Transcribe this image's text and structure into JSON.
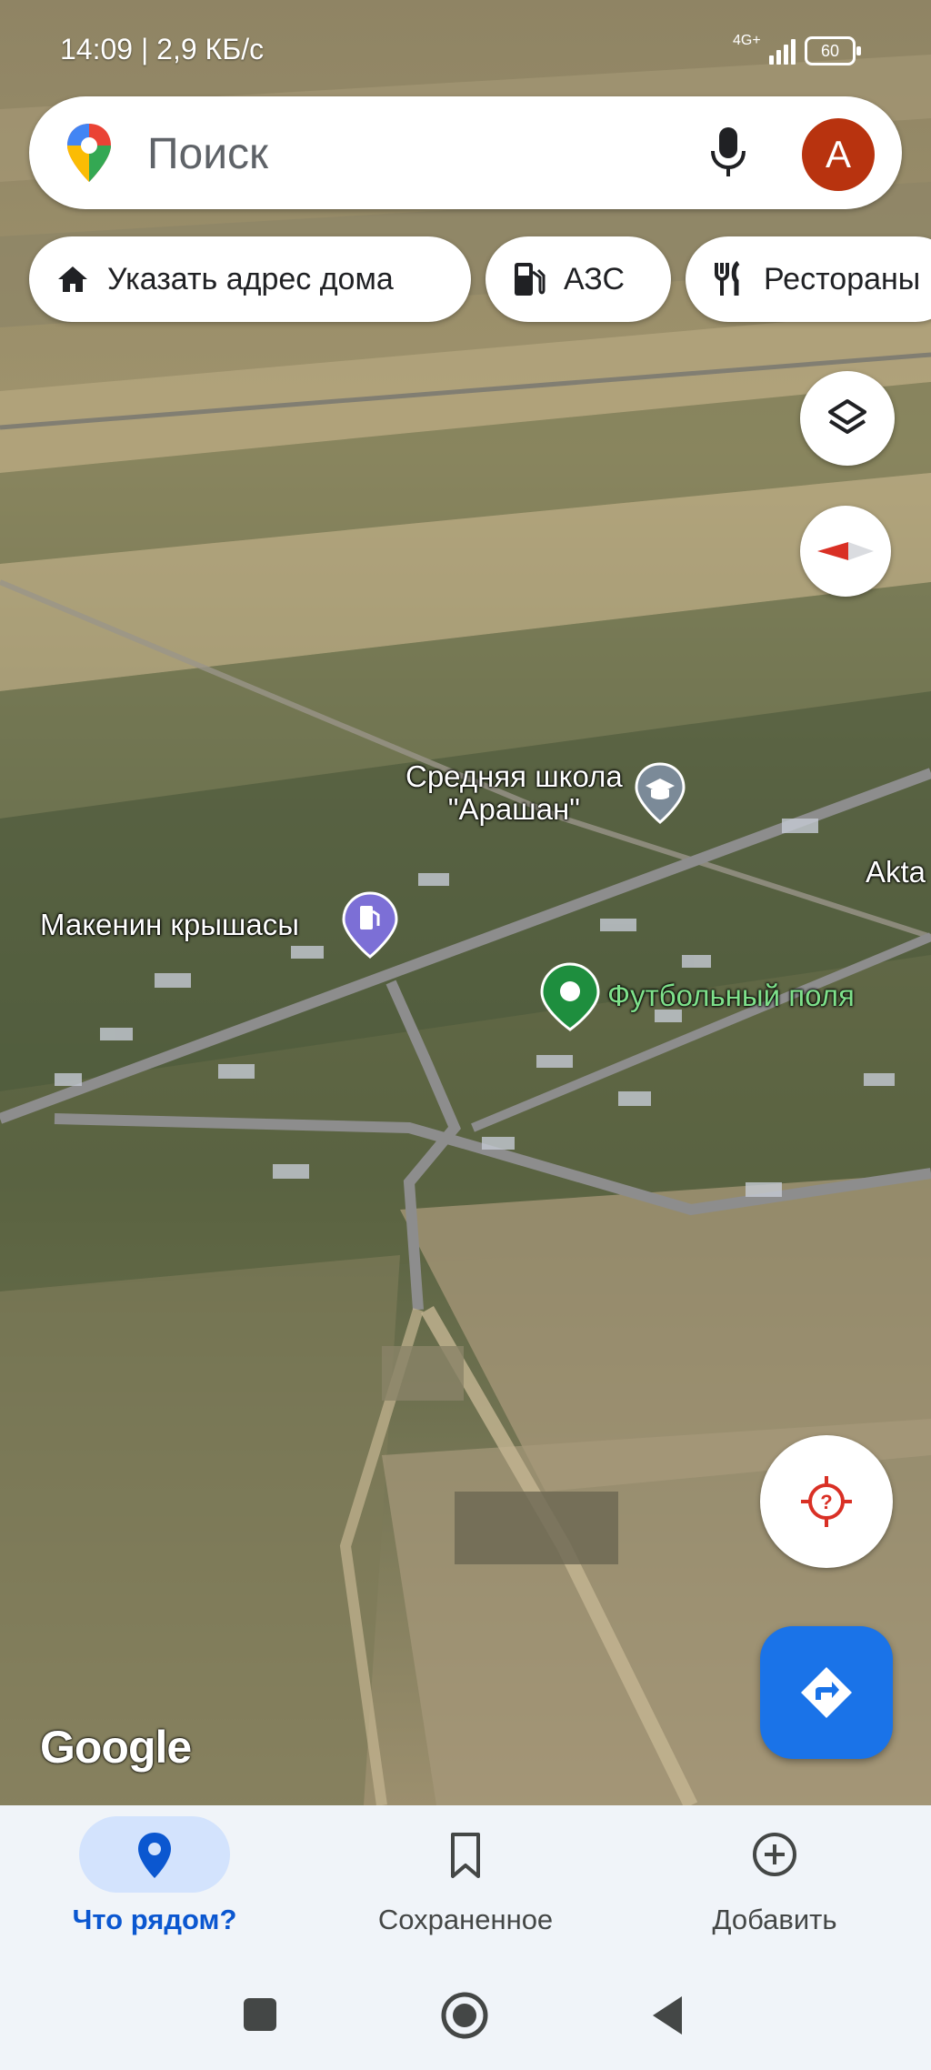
{
  "status_bar": {
    "time": "14:09 | 2,9 КБ/с",
    "network": "4G+",
    "battery": "60"
  },
  "search": {
    "placeholder": "Поиск",
    "avatar_letter": "A",
    "avatar_color": "#b8330f"
  },
  "chips": [
    {
      "label": "Указать адрес дома",
      "icon": "home-icon"
    },
    {
      "label": "АЗС",
      "icon": "gas-station-icon"
    },
    {
      "label": "Рестораны",
      "icon": "restaurant-icon"
    }
  ],
  "map": {
    "labels": {
      "school": "Средняя школа\n\"Арашан\"",
      "gas": "Макенин крышасы",
      "football": "Футбольный поля",
      "akta": "Akta"
    },
    "attribution": "Google"
  },
  "bottom_nav": [
    {
      "label": "Что рядом?",
      "icon": "explore-pin-icon",
      "active": true
    },
    {
      "label": "Сохраненное",
      "icon": "bookmark-icon",
      "active": false
    },
    {
      "label": "Добавить",
      "icon": "add-circle-icon",
      "active": false
    }
  ],
  "colors": {
    "accent": "#1a73e8",
    "active_nav": "#0b57d0"
  }
}
